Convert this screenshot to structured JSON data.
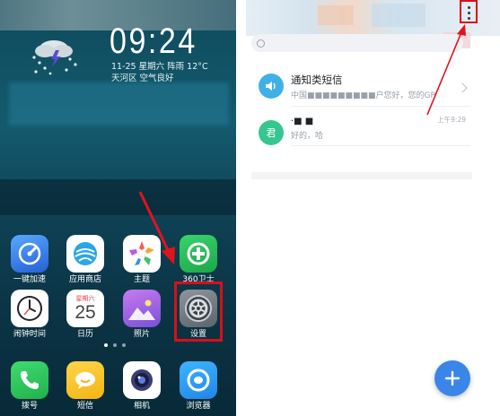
{
  "home": {
    "clock": {
      "time": "09:24",
      "date_line": "11-25  星期六  阵雨  12°C",
      "location_line": "天河区  空气良好"
    },
    "apps_row1": [
      {
        "label": "一键加速",
        "icon": "speed-boost-icon"
      },
      {
        "label": "应用商店",
        "icon": "app-store-icon"
      },
      {
        "label": "主题",
        "icon": "theme-icon"
      },
      {
        "label": "360卫士",
        "icon": "security-360-icon"
      }
    ],
    "apps_row2": [
      {
        "label": "闹钟时间",
        "icon": "alarm-clock-icon"
      },
      {
        "label": "日历",
        "icon": "calendar-icon",
        "calendar_weekday": "星期六",
        "calendar_day": "25"
      },
      {
        "label": "照片",
        "icon": "photos-icon"
      },
      {
        "label": "设置",
        "icon": "settings-gear-icon"
      }
    ],
    "dock": [
      {
        "label": "拨号",
        "icon": "phone-icon"
      },
      {
        "label": "短信",
        "icon": "sms-icon"
      },
      {
        "label": "相机",
        "icon": "camera-icon"
      },
      {
        "label": "浏览器",
        "icon": "browser-icon"
      }
    ],
    "page_indicator": {
      "pages": 3,
      "current": 1
    }
  },
  "messages": {
    "rows": [
      {
        "title": "通知类短信",
        "preview": "中国■■■■■■■■■户您好，您的GP",
        "time": "",
        "avatar_color": "#3fb1e6"
      },
      {
        "title": "·■ ■",
        "preview": "好的，哈",
        "time": "上午9:29",
        "avatar_text": "君",
        "avatar_color": "#36c690"
      }
    ],
    "fab_icon": "plus-icon"
  },
  "colors": {
    "highlight": "#d90f17",
    "fab": "#3a86e8"
  }
}
